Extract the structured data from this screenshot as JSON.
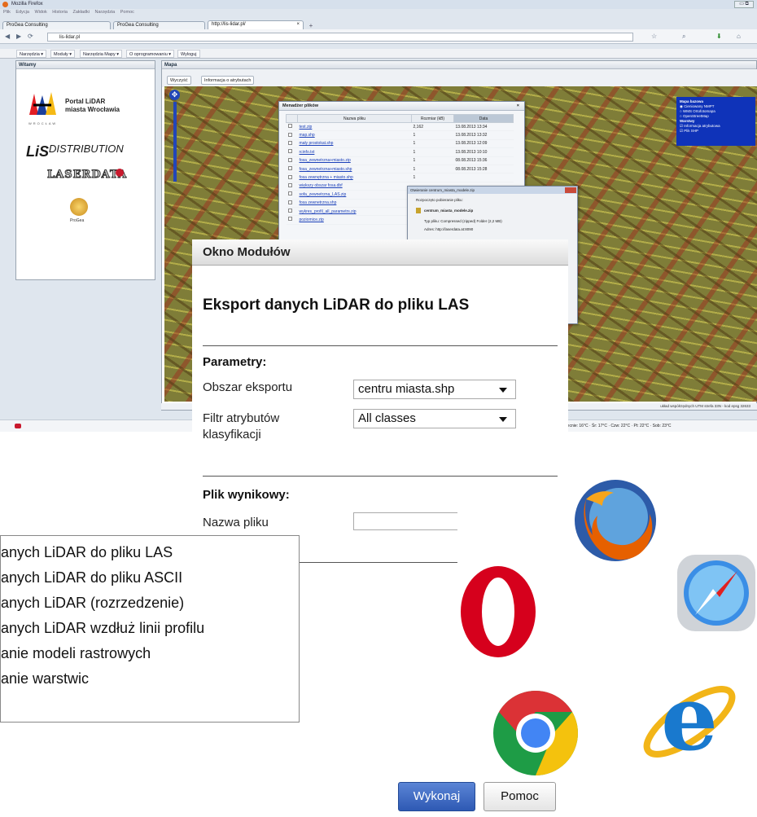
{
  "browser": {
    "title": "Mozilla Firefox",
    "menu": [
      "Plik",
      "Edycja",
      "Widok",
      "Historia",
      "Zakładki",
      "Narzędzia",
      "Pomoc"
    ],
    "tabs": [
      {
        "label": "ProGea Consulting"
      },
      {
        "label": "ProGea Consulting"
      },
      {
        "label": "http://lis-lidar.pl/"
      }
    ],
    "tab_close": "×",
    "new_tab": "+",
    "url": "lis-lidar.pl"
  },
  "app_toolbar": {
    "items": [
      "Narzędzia ▾",
      "Moduły ▾",
      "Narzędzia Mapy ▾",
      "O oprogramowaniu ▾",
      "Wyloguj"
    ]
  },
  "left_panel": {
    "header": "Witamy",
    "portal_line1": "Portal LiDAR",
    "portal_line2": "miasta Wrocławia",
    "city_caption": "WROCŁAW",
    "lis_main": "LiS",
    "lis_suffix": "DISTRIBUTION",
    "laserdata": "LASERDATA",
    "progea": "ProGea"
  },
  "map_panel": {
    "header": "Mapa",
    "btn_clear": "Wyczyść",
    "btn_info": "Informacja o atrybutach",
    "status": "układ współrzędnych UTM strefa 33N - kod epsg 32633",
    "layers": {
      "title": "Mapa bazowa",
      "options": [
        "Cieniowany NMPT",
        "WMS Ortofotomapa",
        "OpenStreetMap"
      ],
      "group2": "Warstwy",
      "checks": [
        "Informacja atrybutowa",
        "Plik SHP"
      ]
    }
  },
  "file_manager": {
    "title": "Menadżer plików",
    "close": "×",
    "columns": [
      "Nazwa pliku",
      "Rozmiar (kB)",
      "Data"
    ],
    "rows": [
      {
        "name": "test.zip",
        "size": "2,162",
        "date": "13.08.2013 13:34"
      },
      {
        "name": "map.shp",
        "size": "1",
        "date": "13.08.2013 13:32"
      },
      {
        "name": "mały prostokat.shp",
        "size": "1",
        "date": "13.08.2013 12:09"
      },
      {
        "name": "rcinfo.txt",
        "size": "1",
        "date": "13.08.2013 10:10"
      },
      {
        "name": "fosa_zewnetrzna+miasto.zip",
        "size": "1",
        "date": "08.08.2013 15:36"
      },
      {
        "name": "fosa_zewnetrzna+miasto.shp",
        "size": "1",
        "date": "08.08.2013 15:28"
      },
      {
        "name": "fosa zewnętrzna + miasto.shp",
        "size": "1",
        "date": ""
      },
      {
        "name": "większy obszar fosa.dbf",
        "size": "",
        "date": ""
      },
      {
        "name": "sofa_zewnetrzna_LAS.zip",
        "size": "",
        "date": ""
      },
      {
        "name": "fosa zewnetrzna.shp",
        "size": "",
        "date": ""
      },
      {
        "name": "wykres_profil_all_parametrs.zip",
        "size": "",
        "date": ""
      },
      {
        "name": "poziomice.zip",
        "size": "",
        "date": ""
      }
    ]
  },
  "download_dialog": {
    "title": "Otwieranie centrum_miasta_modele.zip",
    "intro": "Rozpoczęto pobieranie pliku:",
    "filename": "centrum_miasta_modele.zip",
    "type_line": "Typ pliku:  Compressed (zipped) Folder (2,2 MB)",
    "address_line": "Adres:  http://laserdata.at:8090"
  },
  "firefox_status": {
    "weather": "Obecnie: 16°C  ·  Śr: 17°C  ·  Czw: 22°C  ·  Pt: 22°C  ·  Sob: 23°C"
  },
  "module_window": {
    "header": "Okno Modułów",
    "title": "Eksport danych LiDAR do pliku LAS",
    "params_section": "Parametry:",
    "area_label": "Obszar eksportu",
    "area_value": "centru miasta.shp",
    "filter_label_1": "Filtr atrybutów",
    "filter_label_2": "klasyfikacji",
    "filter_value": "All classes",
    "output_section": "Plik wynikowy:",
    "filename_label": "Nazwa pliku",
    "filename_value": "",
    "execute": "Wykonaj",
    "help": "Pomoc"
  },
  "module_list": {
    "items": [
      "anych LiDAR do pliku LAS",
      "anych LiDAR do pliku ASCII",
      "anych LiDAR (rozrzedzenie)",
      "anych LiDAR wzdłuż linii profilu",
      "anie modeli rastrowych",
      "anie warstwic"
    ]
  },
  "browser_icons": {
    "items": [
      "firefox-icon",
      "opera-icon",
      "safari-icon",
      "chrome-icon",
      "ie-icon"
    ],
    "opera_glyph": "O",
    "ie_glyph": "e"
  },
  "colors": {
    "accent_blue": "#2e59b4",
    "layer_panel": "#0f33b9",
    "map_base": "#7f7d38"
  }
}
